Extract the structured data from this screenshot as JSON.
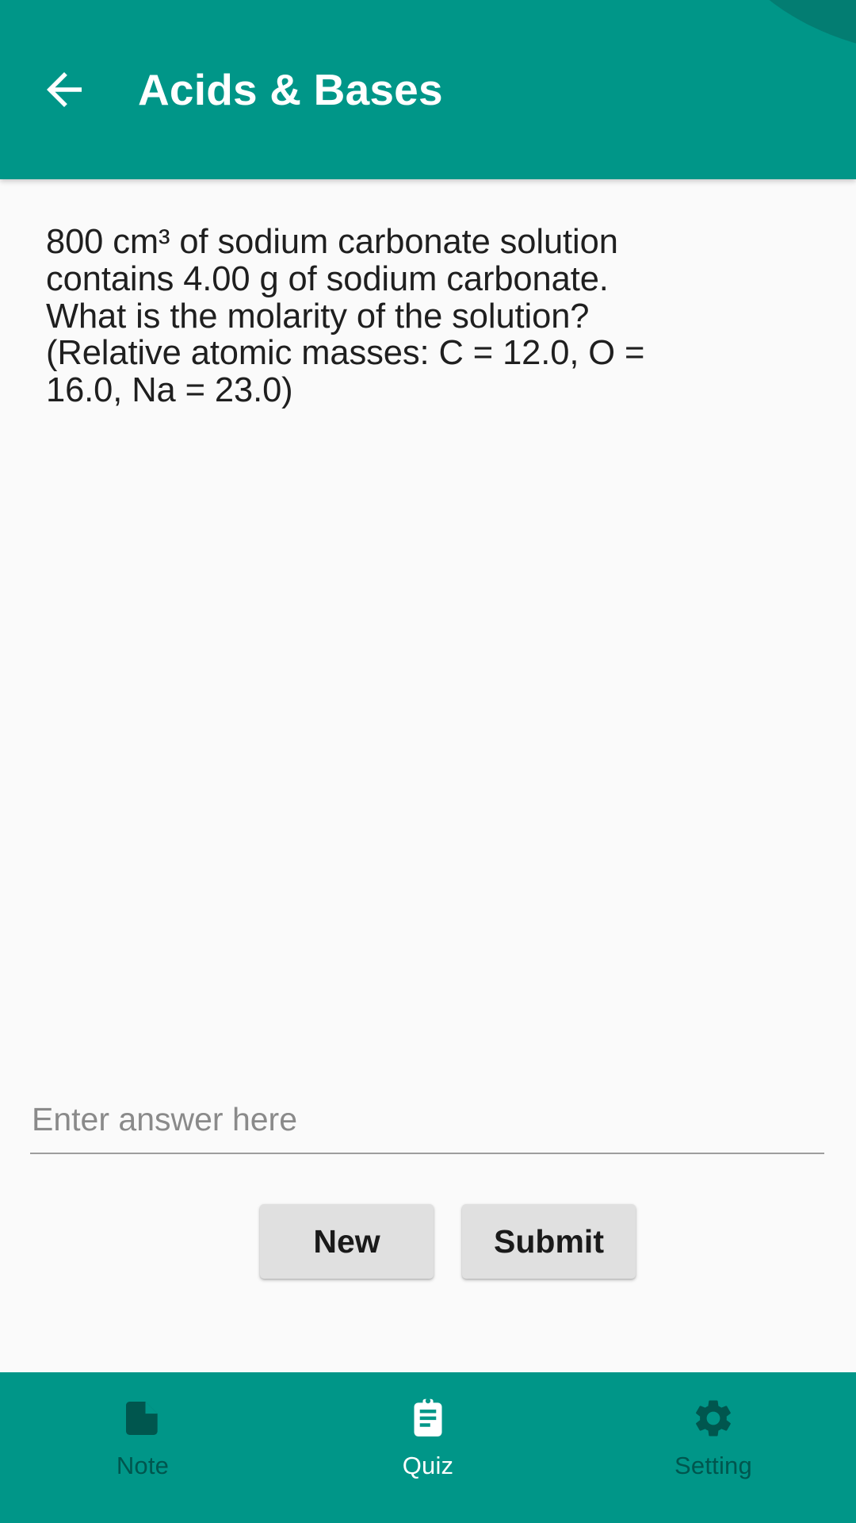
{
  "appbar": {
    "back_icon": "back-arrow-icon",
    "title": "Acids & Bases",
    "background_color": "#009688",
    "title_color": "#ffffff"
  },
  "quiz": {
    "question": "800 cm³ of sodium carbonate solution contains 4.00 g of sodium carbonate. What is the molarity of the solution?\n(Relative atomic masses: C = 12.0, O = 16.0, Na = 23.0)",
    "question_lines": [
      "800 cm³ of sodium carbonate solution",
      "contains 4.00 g of sodium carbonate. What",
      "is the molarity of the solution?",
      "(Relative atomic masses: C = 12.0, O =",
      "16.0, Na = 23.0)"
    ],
    "answer_field": {
      "value": "",
      "placeholder": "Enter answer here"
    },
    "buttons": {
      "new_label": "New",
      "submit_label": "Submit"
    }
  },
  "bottom_nav": {
    "active": "Quiz",
    "items": [
      {
        "label": "Note",
        "icon": "note-document-icon",
        "active": false
      },
      {
        "label": "Quiz",
        "icon": "clipboard-icon",
        "active": true
      },
      {
        "label": "Setting",
        "icon": "gear-icon",
        "active": false
      }
    ],
    "background_color": "#009688",
    "inactive_color": "#00564e",
    "active_color": "#ffffff"
  },
  "theme": {
    "accent": "#009688",
    "accent_dark": "#00564e",
    "page_background": "#fafafa",
    "button_background": "#e0e0e0",
    "text_primary": "#1f1f1f",
    "placeholder": "#8a8a8a"
  }
}
